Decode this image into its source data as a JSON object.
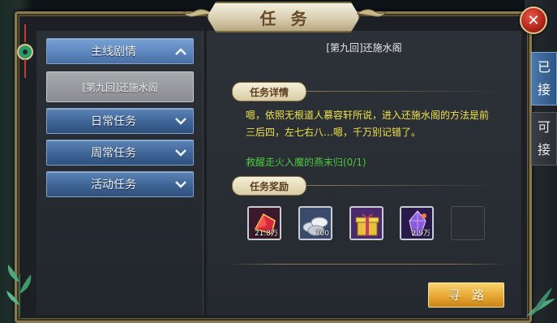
{
  "window": {
    "title": "任务",
    "close_symbol": "✕"
  },
  "categories": [
    {
      "label": "主线剧情",
      "expanded": true
    },
    {
      "label": "日常任务",
      "expanded": false
    },
    {
      "label": "周常任务",
      "expanded": false
    },
    {
      "label": "活动任务",
      "expanded": false
    }
  ],
  "quest_list": [
    {
      "label": "[第九回]还施水阁",
      "selected": true
    }
  ],
  "detail": {
    "quest_title": "[第九回]还施水阁",
    "details_label": "任务详情",
    "description": "嗯，依照无根道人慕容轩所说，进入还施水阁的方法是前三后四，左七右八…嗯，千万别记错了。",
    "objective": "救醒走火入魔的燕末归(0/1)",
    "rewards_label": "任务奖励",
    "rewards": [
      {
        "icon": "ruby-icon",
        "count": "21.8万"
      },
      {
        "icon": "silver-coins-icon",
        "count": "700"
      },
      {
        "icon": "gift-box-icon",
        "count": ""
      },
      {
        "icon": "crystal-icon",
        "count": "2.9万"
      },
      {
        "icon": "",
        "count": ""
      }
    ],
    "navigate_button": "寻路"
  },
  "side_tabs": [
    {
      "label_1": "已",
      "label_2": "接",
      "active": true
    },
    {
      "label_1": "可",
      "label_2": "接",
      "active": false
    }
  ],
  "colors": {
    "description_text": "#f2e24a",
    "objective_text": "#4ec63e",
    "category_button": "#3e6496",
    "navigate_button": "#e8a832"
  }
}
